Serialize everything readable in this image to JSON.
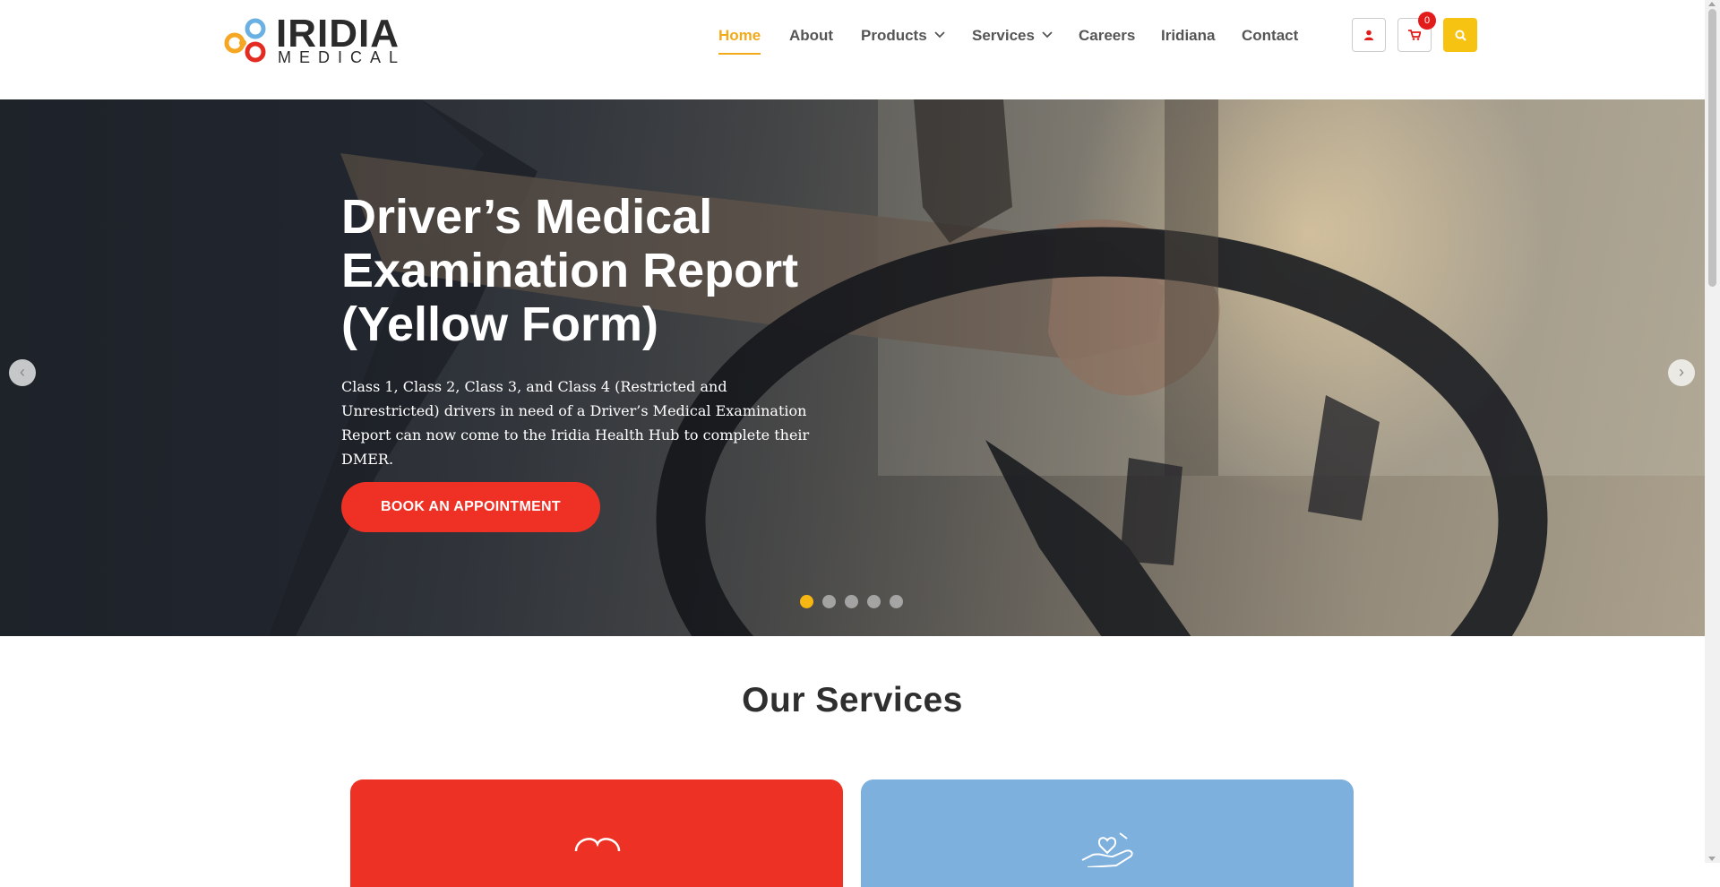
{
  "brand": {
    "name": "IRIDIA",
    "subtitle": "MEDICAL"
  },
  "nav": {
    "items": [
      {
        "label": "Home"
      },
      {
        "label": "About"
      },
      {
        "label": "Products"
      },
      {
        "label": "Services"
      },
      {
        "label": "Careers"
      },
      {
        "label": "Iridiana"
      },
      {
        "label": "Contact"
      }
    ],
    "active": "Home"
  },
  "header_actions": {
    "account_icon": "user-icon",
    "cart_icon": "cart-icon",
    "cart_count": "0",
    "search_icon": "search-icon"
  },
  "hero": {
    "title": "Driver’s Medical Examination Report (Yellow Form)",
    "text": "Class 1, Class 2, Class 3, and Class 4 (Restricted and Unrestricted) drivers in need of a Driver’s Medical Examination Report can now come to the Iridia Health Hub to complete their DMER.",
    "button_label": "BOOK AN APPOINTMENT",
    "prev_arrow": "‹",
    "next_arrow": "›",
    "slide_count": 5,
    "active_slide": 1
  },
  "services": {
    "heading": "Our Services",
    "cards": [
      {
        "color": "#ee3125",
        "icon": "heart-hands-icon"
      },
      {
        "color": "#7db0dc",
        "icon": "hand-heart-icon"
      }
    ]
  },
  "colors": {
    "accent": "#f2a91a",
    "primary_red": "#ef3125",
    "search_yellow": "#f7c313",
    "card_blue": "#7db0dc"
  }
}
